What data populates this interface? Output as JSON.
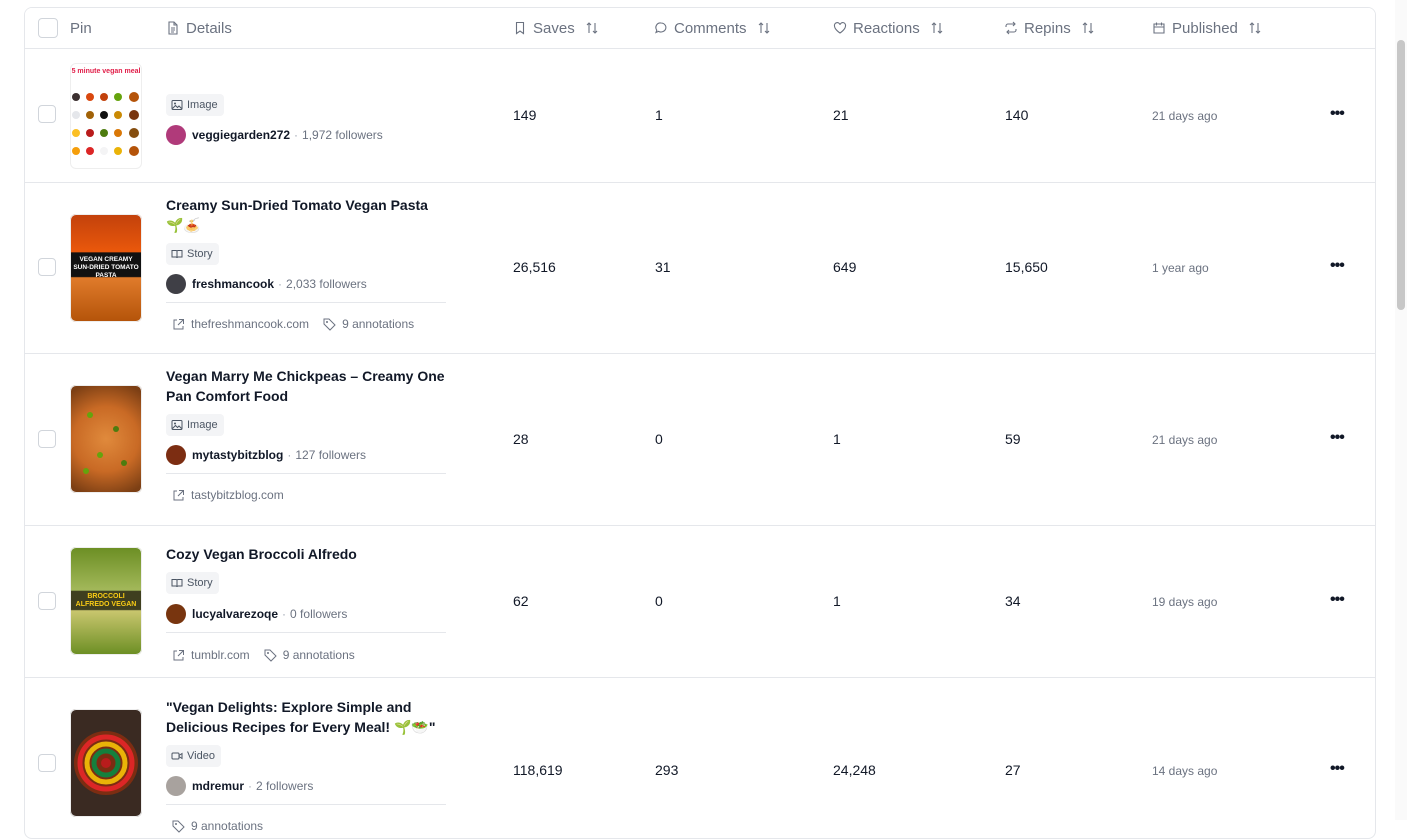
{
  "header": {
    "pin": "Pin",
    "details": "Details",
    "saves": "Saves",
    "comments": "Comments",
    "reactions": "Reactions",
    "repins": "Repins",
    "published": "Published"
  },
  "rows": [
    {
      "title": "",
      "type": "Image",
      "author": "veggiegarden272",
      "followers": "1,972 followers",
      "link": "",
      "annotations": "",
      "saves": "149",
      "comments": "1",
      "reactions": "21",
      "repins": "140",
      "published": "21 days ago",
      "thumb_text": "5 minute vegan meal"
    },
    {
      "title": "Creamy Sun-Dried Tomato Vegan Pasta 🌱🍝",
      "type": "Story",
      "author": "freshmancook",
      "followers": "2,033 followers",
      "link": "thefreshmancook.com",
      "annotations": "9 annotations",
      "saves": "26,516",
      "comments": "31",
      "reactions": "649",
      "repins": "15,650",
      "published": "1 year ago",
      "thumb_text": "VEGAN CREAMY SUN-DRIED TOMATO PASTA"
    },
    {
      "title": "Vegan Marry Me Chickpeas – Creamy One Pan Comfort Food",
      "type": "Image",
      "author": "mytastybitzblog",
      "followers": "127 followers",
      "link": "tastybitzblog.com",
      "annotations": "",
      "saves": "28",
      "comments": "0",
      "reactions": "1",
      "repins": "59",
      "published": "21 days ago"
    },
    {
      "title": "Cozy Vegan Broccoli Alfredo",
      "type": "Story",
      "author": "lucyalvarezoqe",
      "followers": "0 followers",
      "link": "tumblr.com",
      "annotations": "9 annotations",
      "saves": "62",
      "comments": "0",
      "reactions": "1",
      "repins": "34",
      "published": "19 days ago",
      "thumb_text": "BROCCOLI ALFREDO VEGAN"
    },
    {
      "title": "\"Vegan Delights: Explore Simple and Delicious Recipes for Every Meal! 🌱🥗\"",
      "type": "Video",
      "author": "mdremur",
      "followers": "2 followers",
      "link": "",
      "annotations": "9 annotations",
      "saves": "118,619",
      "comments": "293",
      "reactions": "24,248",
      "repins": "27",
      "published": "14 days ago"
    }
  ],
  "row_actions_label": "•••",
  "colors": {
    "border": "#e5e7eb",
    "muted": "#6b7280",
    "badge_bg": "#f3f4f6"
  }
}
